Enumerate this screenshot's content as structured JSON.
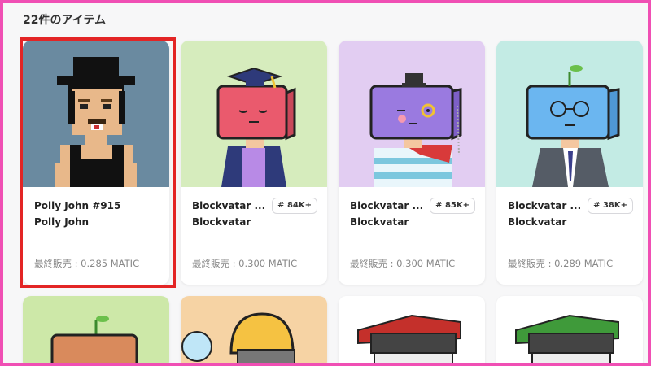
{
  "header": {
    "item_count": "22件のアイテム"
  },
  "items": [
    {
      "name": "Polly John #915",
      "collection": "Polly John",
      "rank": "",
      "price": "最終販売 : 0.285 MATIC",
      "bg": "#6a8aa0",
      "selected": true
    },
    {
      "name": "Blockvatar ...",
      "collection": "Blockvatar",
      "rank": "# 84K+",
      "price": "最終販売 : 0.300 MATIC",
      "bg": "#d6ecbd",
      "selected": false
    },
    {
      "name": "Blockvatar ...",
      "collection": "Blockvatar",
      "rank": "# 85K+",
      "price": "最終販売 : 0.300 MATIC",
      "bg": "#e2cdf2",
      "selected": false
    },
    {
      "name": "Blockvatar ...",
      "collection": "Blockvatar",
      "rank": "# 38K+",
      "price": "最終販売 : 0.289 MATIC",
      "bg": "#c3ebe4",
      "selected": false
    }
  ],
  "row2_backgrounds": [
    "#cde8a8",
    "#f6d3a4",
    "#ffffff",
    "#ffffff"
  ],
  "colors": {
    "frame": "#f04fb4",
    "selection": "#e32525"
  }
}
